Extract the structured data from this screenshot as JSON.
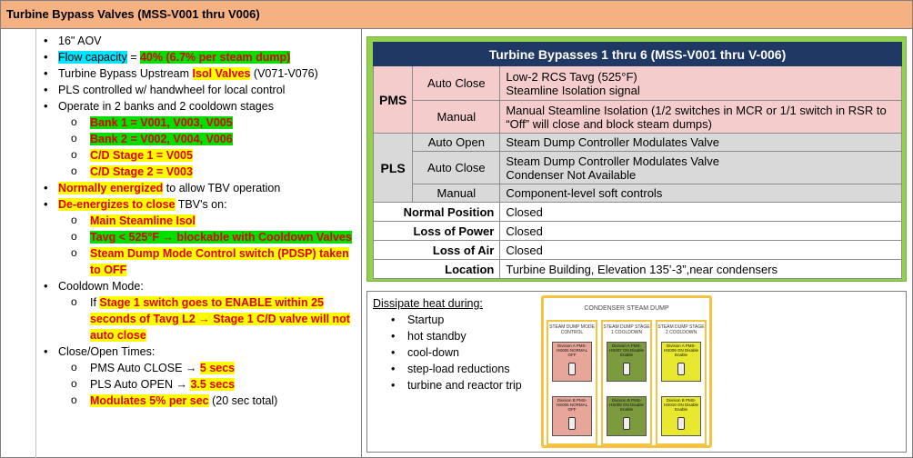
{
  "header": {
    "title": "Turbine Bypass Valves (MSS-V001 thru V006)"
  },
  "left": {
    "aov": "16\" AOV",
    "flow_prefix": "Flow capacity",
    "flow_eq": " = ",
    "flow_value": "40% (6.7% per steam dump)",
    "upstream_prefix": "Turbine Bypass Upstream ",
    "upstream_hl": "Isol Valves",
    "upstream_suffix": " (V071-V076)",
    "pls_ctrl": "PLS controlled w/ handwheel for local control",
    "operate": "Operate in 2 banks and 2 cooldown stages",
    "bank1": "Bank 1 = V001, V003, V005",
    "bank2": "Bank 2 = V002, V004, V006",
    "cd1": "C/D Stage 1 = V005",
    "cd2": "C/D Stage 2 = V003",
    "norm_hl": "Normally energized",
    "norm_suffix": " to allow TBV operation",
    "deen_hl": "De-energizes to close",
    "deen_suffix": " TBV's on:",
    "isol": "Main Steamline Isol",
    "tavg": "Tavg < 525°F → blockable with Cooldown Valves",
    "dump_mode": "Steam Dump Mode Control switch (PDSP) taken to OFF",
    "cooldown_mode": "Cooldown Mode:",
    "if_prefix": "If ",
    "if_hl": "Stage 1 switch goes to ENABLE within 25 seconds of Tavg L2 → Stage 1 C/D valve will not auto close",
    "times": "Close/Open Times:",
    "pms_close_prefix": "PMS Auto CLOSE → ",
    "pms_close_val": "5 secs",
    "pls_open_prefix": "PLS Auto OPEN → ",
    "pls_open_val": "3.5 secs",
    "mod_hl": "Modulates 5% per sec",
    "mod_suffix": " (20 sec total)"
  },
  "table": {
    "title": "Turbine Bypasses 1 thru 6 (MSS-V001 thru V-006)",
    "pms": "PMS",
    "pls": "PLS",
    "auto_close": "Auto Close",
    "manual": "Manual",
    "auto_open": "Auto Open",
    "pms_auto_close_1": "Low-2 RCS Tavg (525°F)",
    "pms_auto_close_2": "Steamline Isolation signal",
    "pms_manual": "Manual Steamline Isolation (1/2 switches in MCR or 1/1 switch in RSR to “Off” will close and block steam dumps)",
    "pls_auto_open": "Steam Dump Controller Modulates Valve",
    "pls_auto_close_1": "Steam Dump Controller Modulates Valve",
    "pls_auto_close_2": "Condenser Not Available",
    "pls_manual": "Component-level soft controls",
    "normal_position_label": "Normal Position",
    "normal_position": "Closed",
    "loss_power_label": "Loss of Power",
    "loss_power": "Closed",
    "loss_air_label": "Loss of Air",
    "loss_air": "Closed",
    "location_label": "Location",
    "location": "Turbine Building, Elevation 135’-3”,near condensers"
  },
  "dissipate": {
    "heading": "Dissipate heat during:",
    "items": [
      "Startup",
      "hot standby",
      "cool-down",
      "step-load reductions",
      "turbine and reactor trip"
    ]
  },
  "panel_image": {
    "title": "CONDENSER STEAM DUMP",
    "col1_cap": "STEAM DUMP MODE CONTROL",
    "col2_cap": "STEAM DUMP STAGE 1 COOLDOWN",
    "col3_cap": "STEAM DUMP STAGE 2 COOLDOWN",
    "sw1_top": "Division A PMS-HS005 NORMAL OFF",
    "sw1_bot": "Division B PMS-HS006 NORMAL OFF",
    "sw2_top": "Division A PMS-HS007 ON Disable Enable",
    "sw2_bot": "Division B PMS-HS008 ON Disable Enable",
    "sw3_top": "Division A PMS-HS009 ON Disable Enable",
    "sw3_bot": "Division B PMS-HS010 ON Disable Enable",
    "colors": {
      "red": "#e8a69a",
      "green": "#7c9b3e",
      "yellow": "#e8e830",
      "border": "#f5c242"
    }
  }
}
